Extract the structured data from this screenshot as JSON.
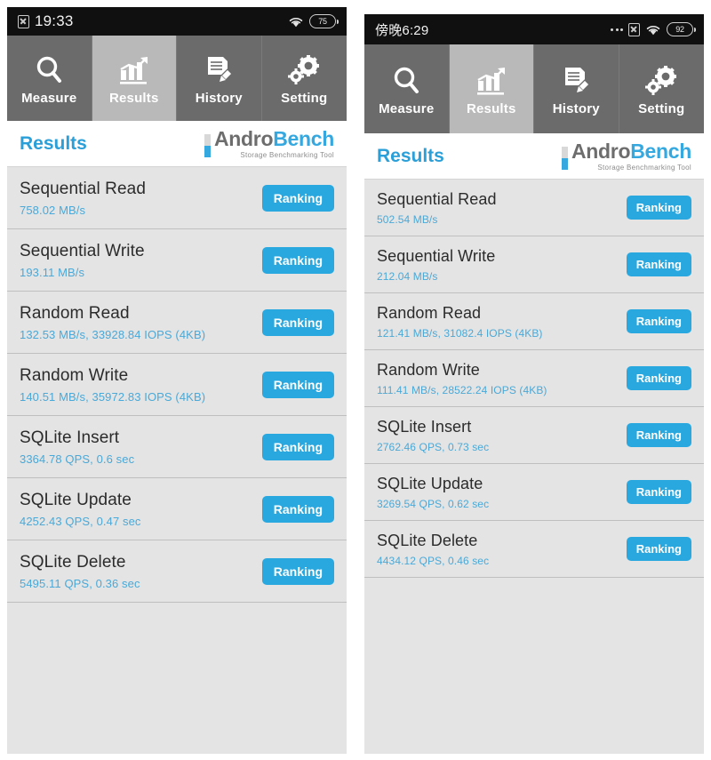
{
  "app": {
    "logo_main_dark": "Andro",
    "logo_main_accent": "Bench",
    "logo_tagline": "Storage Benchmarking Tool",
    "page_title": "Results",
    "accent_color": "#29a8e0",
    "value_color": "#4aa9d8",
    "tabbar_color": "#6b6b6b",
    "tab_selected_color": "#b9b9b9"
  },
  "tabs": [
    {
      "label": "Measure",
      "icon": "magnifier-icon",
      "selected": false
    },
    {
      "label": "Results",
      "icon": "bar-chart-icon",
      "selected": true
    },
    {
      "label": "History",
      "icon": "document-pencil-icon",
      "selected": false
    },
    {
      "label": "Setting",
      "icon": "gears-icon",
      "selected": false
    }
  ],
  "left_phone": {
    "status": {
      "clock": "19:33",
      "battery_percent": "75",
      "icons": [
        "boxed-x-icon",
        "wifi-icon",
        "battery-icon"
      ]
    },
    "rows": [
      {
        "name": "Sequential Read",
        "value": "758.02 MB/s",
        "button": "Ranking"
      },
      {
        "name": "Sequential Write",
        "value": "193.11 MB/s",
        "button": "Ranking"
      },
      {
        "name": "Random Read",
        "value": "132.53 MB/s, 33928.84 IOPS (4KB)",
        "button": "Ranking"
      },
      {
        "name": "Random Write",
        "value": "140.51 MB/s, 35972.83 IOPS (4KB)",
        "button": "Ranking"
      },
      {
        "name": "SQLite Insert",
        "value": "3364.78 QPS, 0.6 sec",
        "button": "Ranking"
      },
      {
        "name": "SQLite Update",
        "value": "4252.43 QPS, 0.47 sec",
        "button": "Ranking"
      },
      {
        "name": "SQLite Delete",
        "value": "5495.11 QPS, 0.36 sec",
        "button": "Ranking"
      }
    ]
  },
  "right_phone": {
    "status": {
      "clock": "傍晚6:29",
      "battery_percent": "92",
      "icons": [
        "more-dots-icon",
        "boxed-x-icon",
        "wifi-icon",
        "battery-icon"
      ]
    },
    "rows": [
      {
        "name": "Sequential Read",
        "value": "502.54 MB/s",
        "button": "Ranking"
      },
      {
        "name": "Sequential Write",
        "value": "212.04 MB/s",
        "button": "Ranking"
      },
      {
        "name": "Random Read",
        "value": "121.41 MB/s, 31082.4 IOPS (4KB)",
        "button": "Ranking"
      },
      {
        "name": "Random Write",
        "value": "111.41 MB/s, 28522.24 IOPS (4KB)",
        "button": "Ranking"
      },
      {
        "name": "SQLite Insert",
        "value": "2762.46 QPS, 0.73 sec",
        "button": "Ranking"
      },
      {
        "name": "SQLite Update",
        "value": "3269.54 QPS, 0.62 sec",
        "button": "Ranking"
      },
      {
        "name": "SQLite Delete",
        "value": "4434.12 QPS, 0.46 sec",
        "button": "Ranking"
      }
    ]
  }
}
